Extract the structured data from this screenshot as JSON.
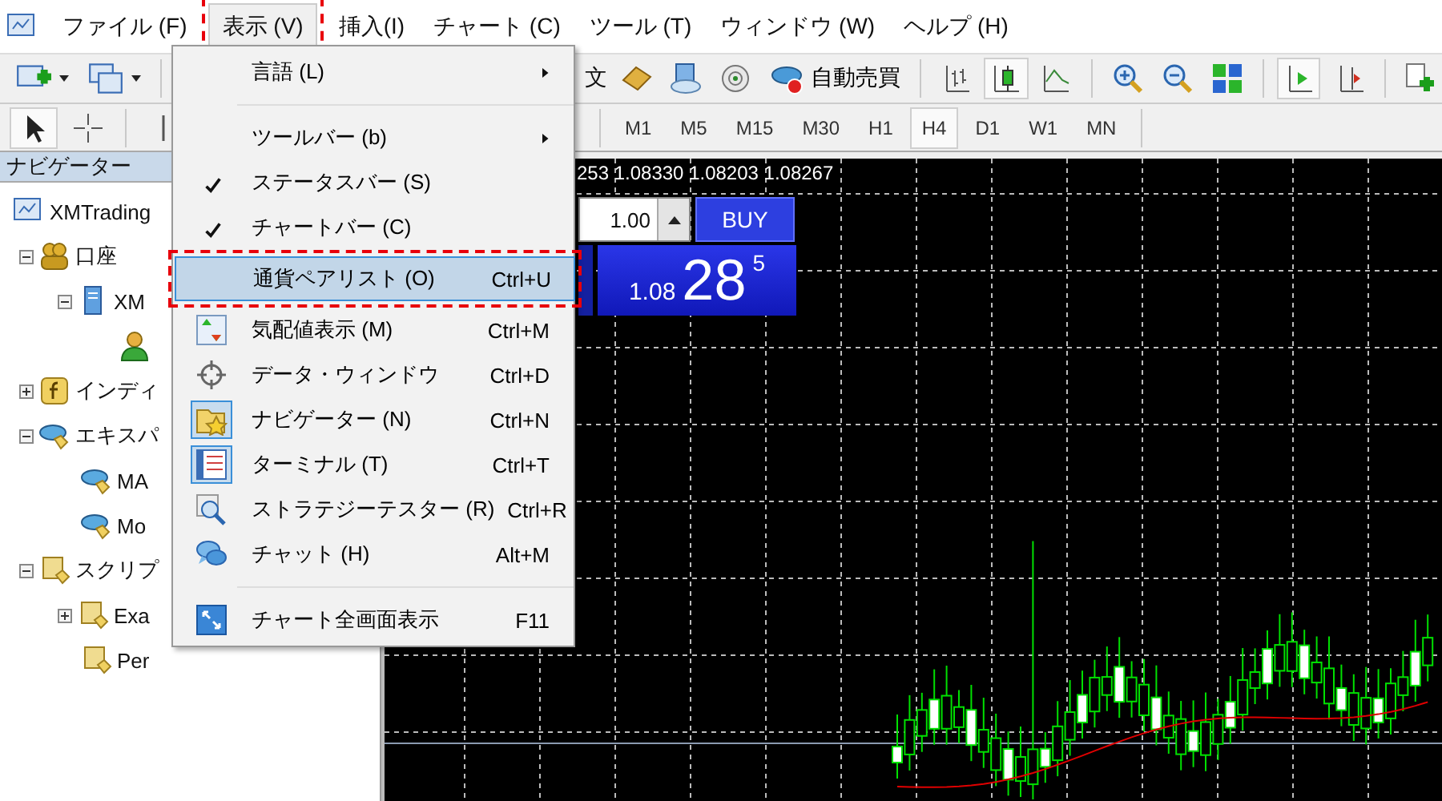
{
  "menubar": {
    "items": [
      {
        "label": "ファイル (F)",
        "selected": false,
        "highlighted": false
      },
      {
        "label": "表示 (V)",
        "selected": true,
        "highlighted": true
      },
      {
        "label": "挿入(I)",
        "selected": false,
        "highlighted": false
      },
      {
        "label": "チャート (C)",
        "selected": false,
        "highlighted": false
      },
      {
        "label": "ツール (T)",
        "selected": false,
        "highlighted": false
      },
      {
        "label": "ウィンドウ (W)",
        "selected": false,
        "highlighted": false
      },
      {
        "label": "ヘルプ (H)",
        "selected": false,
        "highlighted": false
      }
    ]
  },
  "toolbar": {
    "order_label": "文",
    "autotrade_label": "自動売買",
    "chart_tools": [
      {
        "pressed": false
      },
      {
        "pressed": true
      },
      {
        "pressed": false
      },
      {
        "pressed": false
      },
      {
        "pressed": false
      },
      {
        "pressed": false
      },
      {
        "pressed": true
      },
      {
        "pressed": false
      },
      {
        "pressed": false
      }
    ]
  },
  "drawing_tools": [
    {
      "pressed": true
    },
    {
      "pressed": false
    },
    {
      "pressed": false
    }
  ],
  "timeframes": [
    {
      "label": "M1",
      "selected": false
    },
    {
      "label": "M5",
      "selected": false
    },
    {
      "label": "M15",
      "selected": false
    },
    {
      "label": "M30",
      "selected": false
    },
    {
      "label": "H1",
      "selected": false
    },
    {
      "label": "H4",
      "selected": true
    },
    {
      "label": "D1",
      "selected": false
    },
    {
      "label": "W1",
      "selected": false
    },
    {
      "label": "MN",
      "selected": false
    }
  ],
  "navigator": {
    "title": "ナビゲーター",
    "tree": [
      {
        "kind": "terminal",
        "label": "XMTrading",
        "children": [
          {
            "kind": "accounts",
            "label": "口座",
            "expanded": true,
            "children": [
              {
                "kind": "server",
                "label": "XM",
                "expanded": true,
                "children": [
                  {
                    "kind": "account"
                  }
                ]
              }
            ]
          },
          {
            "kind": "indicators",
            "label": "インディ",
            "expanded": false
          },
          {
            "kind": "experts",
            "label": "エキスパ",
            "expanded": true,
            "children": [
              {
                "kind": "expert",
                "label": "MA"
              },
              {
                "kind": "expert",
                "label": "Mo"
              }
            ]
          },
          {
            "kind": "scripts",
            "label": "スクリプ",
            "expanded": true,
            "children": [
              {
                "kind": "script",
                "label": "Exa",
                "expanded": false
              },
              {
                "kind": "script",
                "label": "Per"
              }
            ]
          }
        ]
      }
    ]
  },
  "menu": {
    "items": [
      {
        "kind": "submenu",
        "label": "言語 (L)",
        "selected": false
      },
      {
        "kind": "separator"
      },
      {
        "kind": "submenu",
        "label": "ツールバー (b)",
        "selected": false
      },
      {
        "kind": "item",
        "label": "ステータスバー (S)",
        "checked": true,
        "selected": false
      },
      {
        "kind": "item",
        "label": "チャートバー (C)",
        "checked": true,
        "selected": false
      },
      {
        "kind": "item",
        "label": "通貨ペアリスト (O)",
        "shortcut": "Ctrl+U",
        "checked": false,
        "selected": true,
        "highlighted": true
      },
      {
        "kind": "item",
        "label": "気配値表示 (M)",
        "shortcut": "Ctrl+M",
        "checked": false,
        "selected": false,
        "active": false
      },
      {
        "kind": "item",
        "label": "データ・ウィンドウ",
        "shortcut": "Ctrl+D",
        "checked": false,
        "selected": false,
        "active": false
      },
      {
        "kind": "item",
        "label": "ナビゲーター (N)",
        "shortcut": "Ctrl+N",
        "checked": false,
        "selected": false,
        "active": true
      },
      {
        "kind": "item",
        "label": "ターミナル (T)",
        "shortcut": "Ctrl+T",
        "checked": false,
        "selected": false,
        "active": true
      },
      {
        "kind": "item",
        "label": "ストラテジーテスター (R)",
        "shortcut": "Ctrl+R",
        "checked": false,
        "selected": false,
        "active": false
      },
      {
        "kind": "item",
        "label": "チャット (H)",
        "shortcut": "Alt+M",
        "checked": false,
        "selected": false,
        "active": false
      },
      {
        "kind": "separator"
      },
      {
        "kind": "item",
        "label": "チャート全画面表示",
        "shortcut": "F11",
        "checked": false,
        "selected": false,
        "active": false
      }
    ]
  },
  "chart": {
    "ohlc": "253 1.08330 1.08203 1.08267",
    "lot": "1.00",
    "buy_label": "BUY",
    "ask_prefix": "1.08",
    "ask_big": "28",
    "ask_sup": "5"
  }
}
